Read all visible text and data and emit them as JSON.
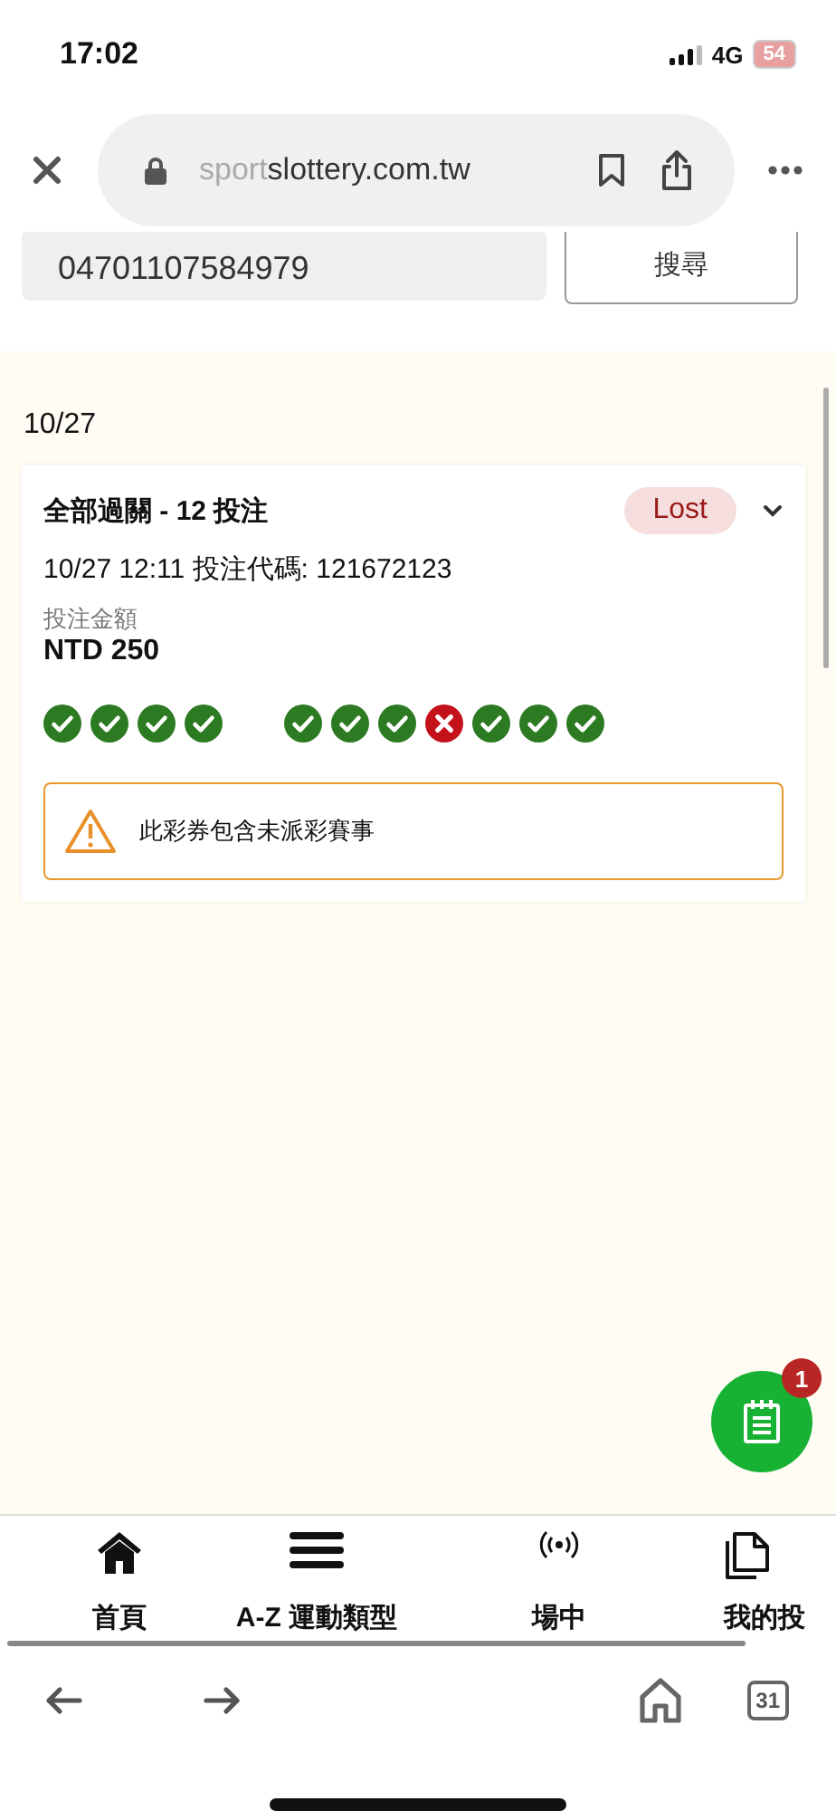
{
  "status_bar": {
    "time": "17:02",
    "network": "4G",
    "battery": "54"
  },
  "browser": {
    "url_dim": "sport",
    "url": "slottery.com.tw"
  },
  "search": {
    "value": "04701107584979",
    "button": "搜尋"
  },
  "date": "10/27",
  "bet": {
    "title": "全部過關 - 12 投注",
    "result": "Lost",
    "info": "10/27 12:11 投注代碼: 121672123",
    "amount_label": "投注金額",
    "amount": "NTD 250",
    "legs": [
      {
        "kind": "won"
      },
      {
        "kind": "won"
      },
      {
        "kind": "won"
      },
      {
        "kind": "won"
      },
      {
        "kind": "pending"
      },
      {
        "kind": "won"
      },
      {
        "kind": "won"
      },
      {
        "kind": "won"
      },
      {
        "kind": "lost"
      },
      {
        "kind": "won"
      },
      {
        "kind": "won"
      },
      {
        "kind": "won"
      }
    ],
    "notice": "此彩券包含未派彩賽事"
  },
  "fab": {
    "badge": "1"
  },
  "nav": [
    {
      "label": "首頁",
      "kind": "home"
    },
    {
      "label": "A-Z 運動類型",
      "kind": "sports"
    },
    {
      "label": "場中",
      "kind": "live"
    },
    {
      "label": "我的投",
      "kind": "bets"
    }
  ],
  "toolbar": {
    "tabs": "31"
  }
}
